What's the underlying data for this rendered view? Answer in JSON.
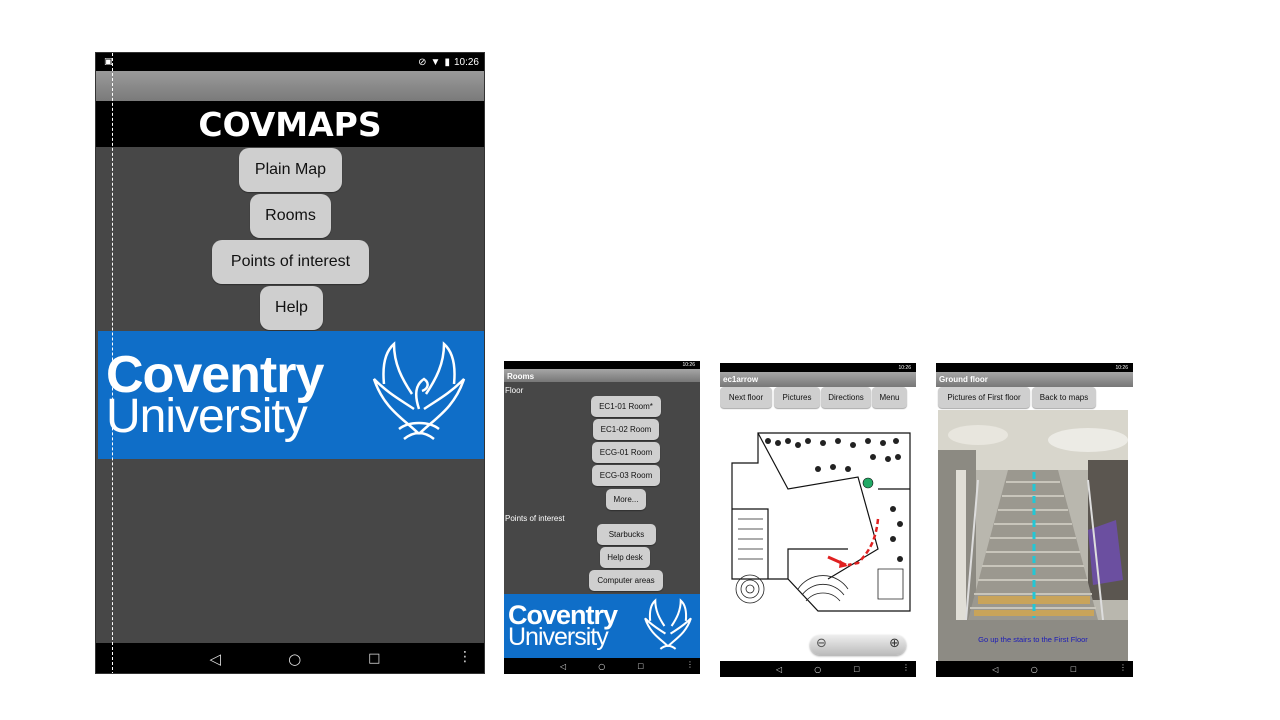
{
  "screen1": {
    "status_time": "10:26",
    "app_title": "COVMAPS",
    "menu": [
      "Plain Map",
      "Rooms",
      "Points of interest",
      "Help"
    ],
    "logo_line1": "Coventry",
    "logo_line2": "University"
  },
  "screen2": {
    "status_time": "10:26",
    "title": "Rooms",
    "floor_label": "Floor",
    "rooms": [
      "EC1-01 Room*",
      "EC1-02 Room",
      "ECG-01  Room",
      "ECG-03 Room",
      "More..."
    ],
    "poi_label": "Points of interest",
    "pois": [
      "Starbucks",
      "Help desk",
      "Computer areas"
    ],
    "logo_line1": "Coventry",
    "logo_line2": "University"
  },
  "screen3": {
    "status_time": "10:26",
    "title": "ec1arrow",
    "buttons": [
      "Next floor",
      "Pictures",
      "Directions",
      "Menu"
    ]
  },
  "screen4": {
    "status_time": "10:26",
    "title": "Ground floor",
    "buttons": [
      "Pictures of First floor",
      "Back to maps"
    ],
    "caption": "Go up the stairs to the First Floor"
  },
  "colors": {
    "brand_blue": "#0f6ec8",
    "dark_bg": "#474747",
    "button_grey": "#cfcfcf"
  },
  "icons": [
    "back-icon",
    "home-icon",
    "recents-icon",
    "more-icon",
    "wifi-icon",
    "battery-icon",
    "dnd-icon",
    "zoom-out-icon",
    "zoom-in-icon"
  ]
}
